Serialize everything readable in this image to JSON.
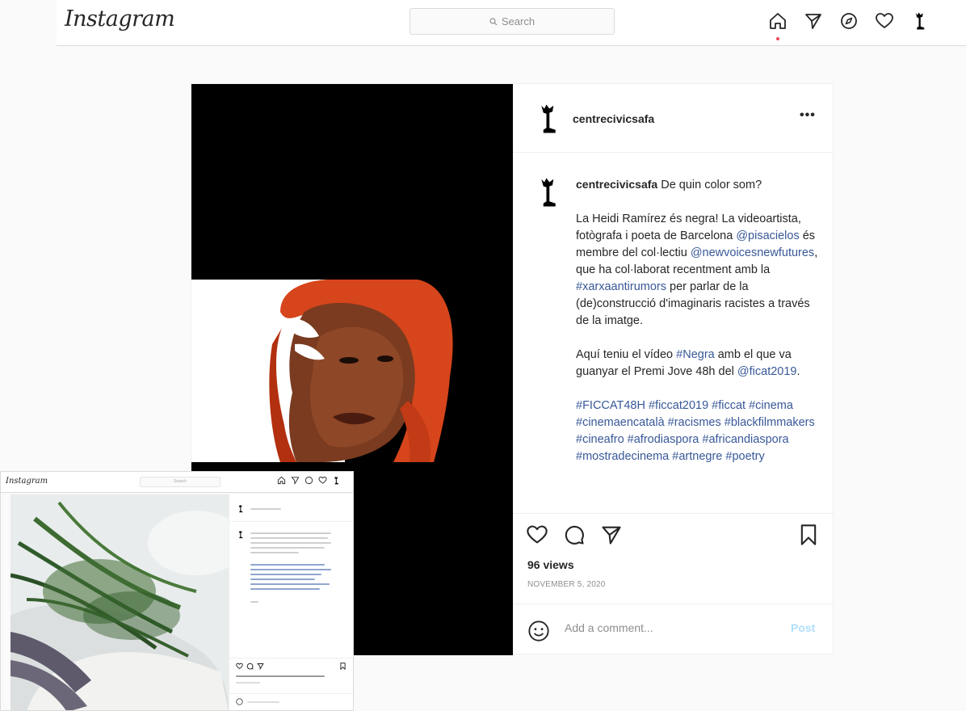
{
  "app": {
    "logo": "Instagram",
    "search_placeholder": "Search",
    "nav_icons": [
      "home-icon",
      "direct-icon",
      "explore-icon",
      "activity-heart-icon",
      "profile-avatar"
    ]
  },
  "post": {
    "username": "centrecivicsafa",
    "more_label": "•••",
    "caption": {
      "lead": "De quin color som?",
      "p1_parts": [
        "La Heidi Ramírez és negra! La videoartista, fotògrafa i poeta de Barcelona ",
        "@pisacielos",
        " és membre del col·lectiu ",
        "@newvoicesnewfutures",
        ", que ha col·laborat recentment amb la ",
        "#xarxaantirumors",
        " per parlar de la (de)construcció d'imaginaris racistes a través de la imatge."
      ],
      "p2_parts": [
        "Aquí teniu el vídeo ",
        "#Negra",
        " amb el que va guanyar el Premi Jove 48h del ",
        "@ficat2019",
        "."
      ],
      "hashtags": "#FICCAT48H #ficcat2019 #ficcat #cinema #cinemaencatalà #racismes #blackfilmmakers #cineafro #afrodiaspora #africandiaspora #mostradecinema #artnegre #poetry"
    },
    "views": "96 views",
    "date": "NOVEMBER 5, 2020",
    "comment_placeholder": "Add a comment...",
    "post_button": "Post"
  },
  "inset": {
    "logo": "Instagram",
    "search_placeholder": "Search"
  },
  "colors": {
    "link": "#385898",
    "notification_dot": "#ed4956",
    "post_button": "#b2dffc"
  }
}
